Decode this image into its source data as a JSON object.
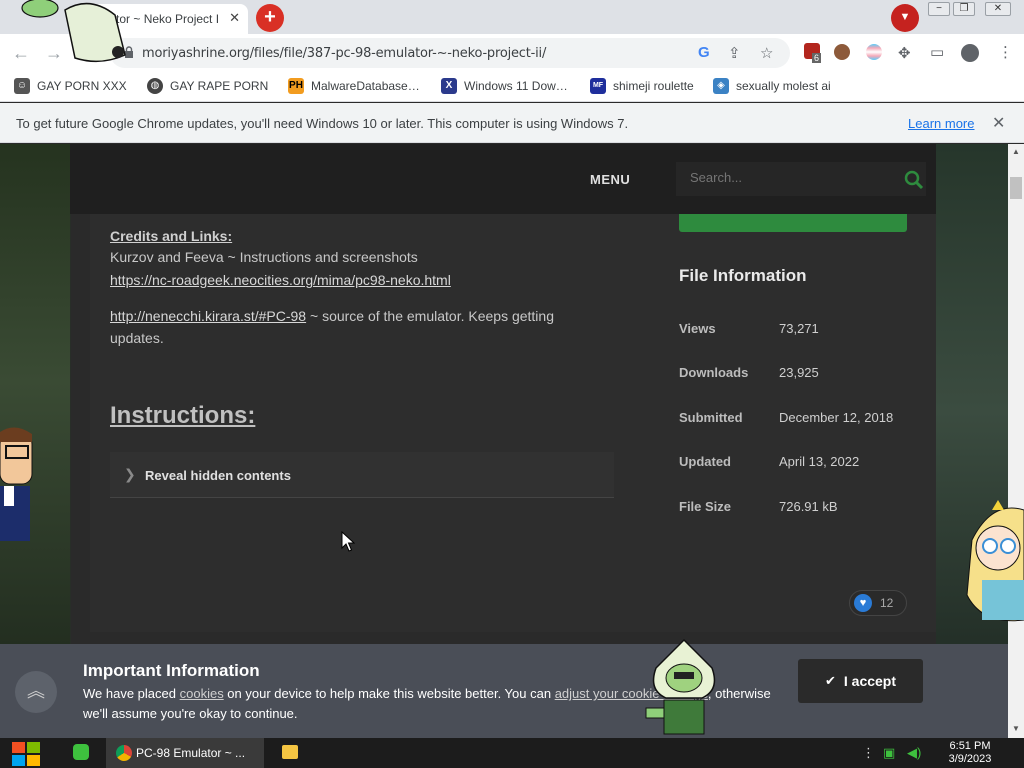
{
  "browser": {
    "tab_title": "ulator ~ Neko Project II",
    "url": "moriyashrine.org/files/file/387-pc-98-emulator-~-neko-project-ii/",
    "window_buttons": [
      "−",
      "❐",
      "✕"
    ],
    "extension_badge": "6"
  },
  "bookmarks": [
    {
      "label": "GAY PORN XXX",
      "icon": "site-icon"
    },
    {
      "label": "GAY RAPE PORN",
      "icon": "globe-icon"
    },
    {
      "label": "MalwareDatabase…",
      "icon": "ph-icon",
      "icon_text": "PH"
    },
    {
      "label": "Windows 11 Dow…",
      "icon": "x-icon",
      "icon_text": "X"
    },
    {
      "label": "shimeji roulette",
      "icon": "mf-icon",
      "icon_text": "MF"
    },
    {
      "label": "sexually molest ai",
      "icon": "bot-icon"
    }
  ],
  "infobar": {
    "message": "To get future Google Chrome updates, you'll need Windows 10 or later. This computer is using Windows 7.",
    "learn_more": "Learn more"
  },
  "site": {
    "menu": "MENU",
    "search_placeholder": "Search..."
  },
  "article": {
    "credits_title": "Credits and Links:",
    "credits_line": "Kurzov and Feeva ~ Instructions and screenshots",
    "link1": "https://nc-roadgeek.neocities.org/mima/pc98-neko.html",
    "link2": "http://nenecchi.kirara.st/#PC-98",
    "link2_suffix": " ~ source of the emulator. Keeps getting updates.",
    "instructions_title": "Instructions:",
    "spoiler_label": "Reveal hidden contents"
  },
  "file_info": {
    "title": "File Information",
    "rows": [
      {
        "label": "Views",
        "value": "73,271"
      },
      {
        "label": "Downloads",
        "value": "23,925"
      },
      {
        "label": "Submitted",
        "value": "December 12, 2018"
      },
      {
        "label": "Updated",
        "value": "April 13, 2022"
      },
      {
        "label": "File Size",
        "value": "726.91 kB"
      }
    ],
    "likes": "12"
  },
  "cookie": {
    "title": "Important Information",
    "text_before": "We have placed ",
    "cookies_link": "cookies",
    "text_middle": " on your device to help make this website better. You can ",
    "adjust_link": "adjust your cookie settings",
    "text_after": ", otherwise we'll assume you're okay to continue.",
    "accept_label": "I accept"
  },
  "taskbar": {
    "window_label": "PC-98 Emulator ~ ...",
    "time": "6:51 PM",
    "date": "3/9/2023"
  },
  "colors": {
    "accent_green": "#2e8b3e",
    "search_green": "#2e8b3e",
    "like_blue": "#2a7bd6",
    "newtab_red": "#d93025"
  }
}
